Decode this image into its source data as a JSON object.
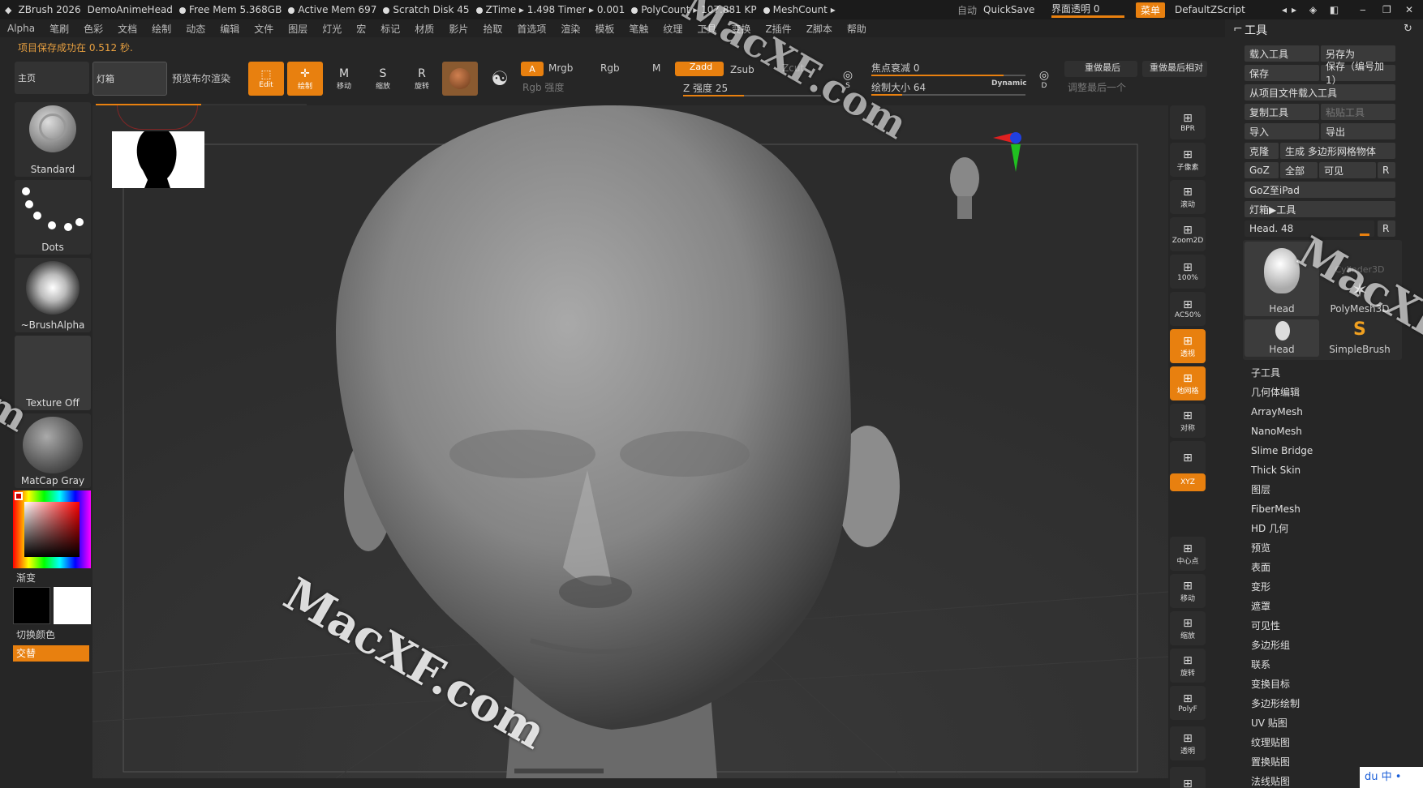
{
  "titlebar": {
    "app": "ZBrush 2026",
    "file": "DemoAnimeHead",
    "free_mem": "Free Mem 5.368GB",
    "active_mem": "Active Mem 697",
    "scratch": "Scratch Disk 45",
    "ztime": "ZTime ▸ 1.498 Timer ▸ 0.001",
    "polycount": "PolyCount ▸ 107.881 KP",
    "meshcount": "MeshCount ▸",
    "auto": "自动",
    "quicksave": "QuickSave",
    "ui_opacity": "界面透明 0",
    "menu": "菜单",
    "zscript": "DefaultZScript"
  },
  "menubar": [
    "Alpha",
    "笔刷",
    "色彩",
    "文档",
    "绘制",
    "动态",
    "编辑",
    "文件",
    "图层",
    "灯光",
    "宏",
    "标记",
    "材质",
    "影片",
    "拾取",
    "首选项",
    "渲染",
    "模板",
    "笔触",
    "纹理",
    "工具",
    "变换",
    "Z插件",
    "Z脚本",
    "帮助"
  ],
  "notice": "项目保存成功在 0.512 秒.",
  "toolbar": {
    "home": "主页",
    "lightbox": "灯箱",
    "preview_bpr": "预览布尔渲染",
    "edit": "Edit",
    "draw": "绘制",
    "move": "移动",
    "scale": "缩放",
    "rotate": "旋转",
    "a": "A",
    "mrgb": "Mrgb",
    "rgb": "Rgb",
    "m": "M",
    "rgb_intensity": "Rgb 强度",
    "zadd": "Zadd",
    "zsub": "Zsub",
    "zcut": "Zcut",
    "z_intensity": "Z 强度 25",
    "focal_shift": "焦点衰减 0",
    "draw_size": "绘制大小 64",
    "dynamic": "Dynamic",
    "redo_last": "重做最后",
    "redo_last_rel": "重做最后相对",
    "adjust_last": "调整最后一个",
    "s": "S",
    "d": "D"
  },
  "left_panel": {
    "brush": "Standard",
    "stroke": "Dots",
    "alpha": "~BrushAlpha",
    "texture": "Texture Off",
    "material": "MatCap Gray",
    "gradient": "渐变",
    "switch_color": "切换颜色",
    "alternate": "交替"
  },
  "right_toolbar": [
    "BPR",
    "子像素",
    "滚动",
    "Zoom2D",
    "100%",
    "AC50%",
    "透视",
    "地网格",
    "对称",
    "",
    "XYZ",
    "",
    "",
    "中心点",
    "移动",
    "缩放",
    "旋转",
    "PolyF",
    "透明",
    ""
  ],
  "palette": {
    "title": "工具",
    "load_tool": "载入工具",
    "save_as": "另存为",
    "save": "保存",
    "save_inc": "保存（编号加 1）",
    "load_from_project": "从项目文件载入工具",
    "copy_tool": "复制工具",
    "paste_tool": "粘贴工具",
    "import": "导入",
    "export": "导出",
    "clone": "克隆",
    "make_polymesh": "生成 多边形网格物体",
    "goz": "GoZ",
    "all": "全部",
    "visible": "可见",
    "r": "R",
    "goz_ipad": "GoZ至iPad",
    "lightbox_tool": "灯箱▶工具",
    "head_slider": "Head. 48",
    "tools": [
      "Head",
      "Cylinder3D",
      "PolyMesh3D",
      "Head",
      "SimpleBrush"
    ],
    "menu_items": [
      "子工具",
      "几何体编辑",
      "ArrayMesh",
      "NanoMesh",
      "Slime Bridge",
      "Thick Skin",
      "图层",
      "FiberMesh",
      "HD 几何",
      "预览",
      "表面",
      "变形",
      "遮罩",
      "可见性",
      "多边形组",
      "联系",
      "变换目标",
      "多边形绘制",
      "UV 贴图",
      "纹理贴图",
      "置换贴图",
      "法线贴图"
    ]
  },
  "watermark": "MacXF.com",
  "colors": {
    "accent": "#e8800f",
    "bg": "#262626"
  }
}
